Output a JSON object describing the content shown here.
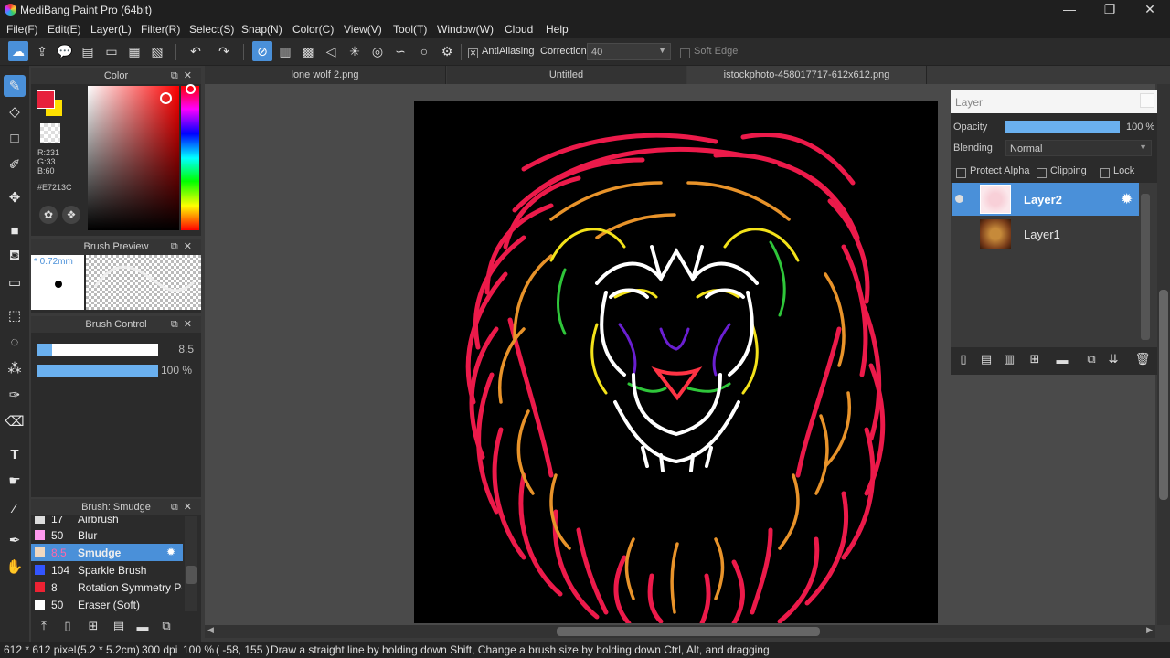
{
  "window": {
    "title": "MediBang Paint Pro (64bit)"
  },
  "menu": [
    "File(F)",
    "Edit(E)",
    "Layer(L)",
    "Filter(R)",
    "Select(S)",
    "Snap(N)",
    "Color(C)",
    "View(V)",
    "Tool(T)",
    "Window(W)",
    "Cloud",
    "Help"
  ],
  "toolbar": {
    "antialiasing_label": "AntiAliasing",
    "correction_label": "Correction",
    "correction_value": "40",
    "soft_edge_label": "Soft Edge"
  },
  "color_panel": {
    "title": "Color",
    "r": "R:231",
    "g": "G:33",
    "b": "B:60",
    "hex": "#E7213C",
    "foreground": "#E7213C",
    "background": "#FFE000"
  },
  "brush_preview": {
    "title": "Brush Preview",
    "size": "* 0.72mm"
  },
  "brush_control": {
    "title": "Brush Control",
    "size_value": "8.5",
    "size_fraction": 0.12,
    "opacity_value": "100 %",
    "opacity_fraction": 1.0
  },
  "brush_list": {
    "title": "Brush: Smudge",
    "items": [
      {
        "size": "17",
        "name": "Airbrush",
        "color": "#dddddd"
      },
      {
        "size": "50",
        "name": "Blur",
        "color": "#ff99ee"
      },
      {
        "size": "8.5",
        "name": "Smudge",
        "color": "#f0d8c0",
        "selected": true
      },
      {
        "size": "104",
        "name": "Sparkle Brush",
        "color": "#3355ff"
      },
      {
        "size": "8",
        "name": "Rotation Symmetry Pe",
        "color": "#ee2233"
      },
      {
        "size": "50",
        "name": "Eraser (Soft)",
        "color": "#ffffff"
      }
    ]
  },
  "tabs": [
    {
      "label": "lone wolf 2.png",
      "active": false
    },
    {
      "label": "Untitled",
      "active": false
    },
    {
      "label": "istockphoto-458017717-612x612.png",
      "active": true
    }
  ],
  "layer_panel": {
    "title": "Layer",
    "opacity_label": "Opacity",
    "opacity_value": "100 %",
    "opacity_fraction": 1.0,
    "blending_label": "Blending",
    "blending_value": "Normal",
    "protect_alpha_label": "Protect Alpha",
    "clipping_label": "Clipping",
    "lock_label": "Lock",
    "layers": [
      {
        "name": "Layer2",
        "selected": true
      },
      {
        "name": "Layer1",
        "selected": false
      }
    ]
  },
  "status": {
    "size": "612 * 612 pixel",
    "cm": "(5.2 * 5.2cm)",
    "dpi": "300 dpi",
    "zoom": "100 %",
    "coords": "( -58, 155 )",
    "hint": "Draw a straight line by holding down Shift, Change a brush size by holding down Ctrl, Alt, and dragging"
  },
  "colors": {
    "accent": "#4a90d9",
    "panel": "#2b2b2b",
    "canvas_bg": "#000000"
  }
}
